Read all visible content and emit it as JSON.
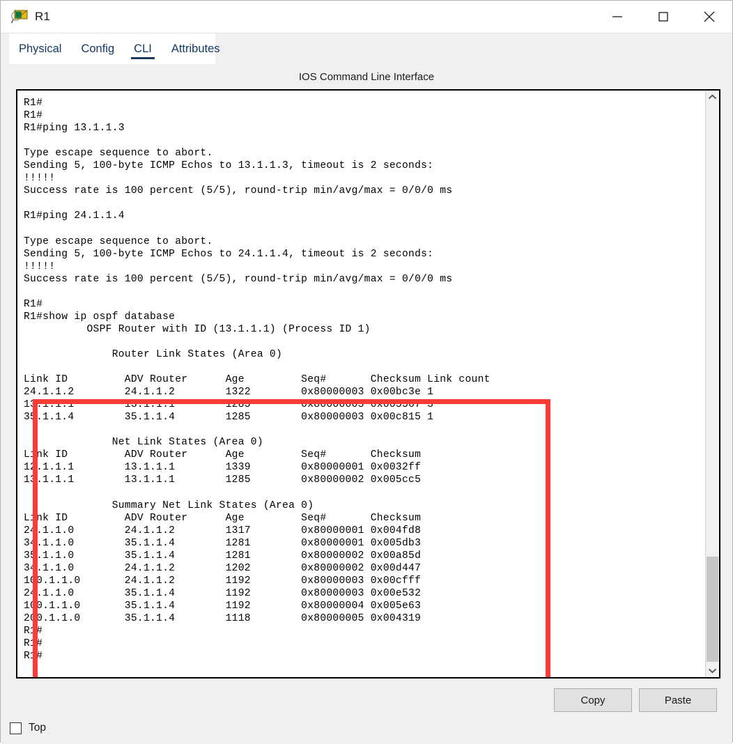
{
  "window": {
    "title": "R1",
    "icon": "packet-tracer-router-icon",
    "controls": {
      "minimize": "minimize-icon",
      "maximize": "maximize-icon",
      "close": "close-icon"
    }
  },
  "tabs": [
    {
      "label": "Physical",
      "active": false
    },
    {
      "label": "Config",
      "active": false
    },
    {
      "label": "CLI",
      "active": true
    },
    {
      "label": "Attributes",
      "active": false
    }
  ],
  "panel": {
    "heading": "IOS Command Line Interface"
  },
  "terminal": {
    "lines": [
      "",
      "R1#",
      "R1#",
      "R1#ping 13.1.1.3",
      "",
      "Type escape sequence to abort.",
      "Sending 5, 100-byte ICMP Echos to 13.1.1.3, timeout is 2 seconds:",
      "!!!!!",
      "Success rate is 100 percent (5/5), round-trip min/avg/max = 0/0/0 ms",
      "",
      "R1#ping 24.1.1.4",
      "",
      "Type escape sequence to abort.",
      "Sending 5, 100-byte ICMP Echos to 24.1.1.4, timeout is 2 seconds:",
      "!!!!!",
      "Success rate is 100 percent (5/5), round-trip min/avg/max = 0/0/0 ms",
      "",
      "R1#",
      "R1#show ip ospf database",
      "          OSPF Router with ID (13.1.1.1) (Process ID 1)",
      "",
      "              Router Link States (Area 0)",
      "",
      "Link ID         ADV Router      Age         Seq#       Checksum Link count",
      "24.1.1.2        24.1.1.2        1322        0x80000003 0x00bc3e 1",
      "13.1.1.1        13.1.1.1        1285        0x80000005 0x005567 3",
      "35.1.1.4        35.1.1.4        1285        0x80000003 0x00c815 1",
      "",
      "              Net Link States (Area 0)",
      "Link ID         ADV Router      Age         Seq#       Checksum",
      "12.1.1.1        13.1.1.1        1339        0x80000001 0x0032ff",
      "13.1.1.1        13.1.1.1        1285        0x80000002 0x005cc5",
      "",
      "              Summary Net Link States (Area 0)",
      "Link ID         ADV Router      Age         Seq#       Checksum",
      "24.1.1.0        24.1.1.2        1317        0x80000001 0x004fd8",
      "34.1.1.0        35.1.1.4        1281        0x80000001 0x005db3",
      "35.1.1.0        35.1.1.4        1281        0x80000002 0x00a85d",
      "34.1.1.0        24.1.1.2        1202        0x80000002 0x00d447",
      "100.1.1.0       24.1.1.2        1192        0x80000003 0x00cfff",
      "24.1.1.0        35.1.1.4        1192        0x80000003 0x00e532",
      "100.1.1.0       35.1.1.4        1192        0x80000004 0x005e63",
      "200.1.1.0       35.1.1.4        1118        0x80000005 0x004319",
      "R1#",
      "R1#",
      "R1#"
    ]
  },
  "highlight": {
    "name": "red-annotation-box",
    "color": "#fb3b35"
  },
  "actions": {
    "copy_label": "Copy",
    "paste_label": "Paste"
  },
  "footer": {
    "top_checkbox_label": "Top",
    "top_checkbox_checked": false
  },
  "scrollbar": {
    "up_arrow": "chevron-up-icon",
    "down_arrow": "chevron-down-icon"
  }
}
